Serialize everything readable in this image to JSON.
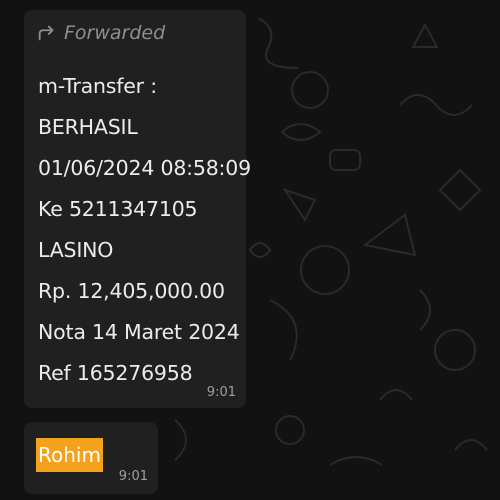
{
  "chat": {
    "messages": [
      {
        "forwarded_label": "Forwarded",
        "lines": [
          "m-Transfer :",
          "BERHASIL",
          "01/06/2024 08:58:09",
          "Ke 5211347105",
          "LASINO",
          "Rp. 12,405,000.00",
          "Nota 14 Maret 2024",
          "Ref 165276958"
        ],
        "time": "9:01",
        "icon": "forward-icon"
      },
      {
        "text": "Rohim",
        "time": "9:01",
        "highlight_color": "#f4a11c"
      }
    ]
  },
  "colors": {
    "background": "#121212",
    "bubble": "#202020",
    "text": "#e9edef",
    "muted": "#8b8f93",
    "highlight": "#f4a11c"
  }
}
